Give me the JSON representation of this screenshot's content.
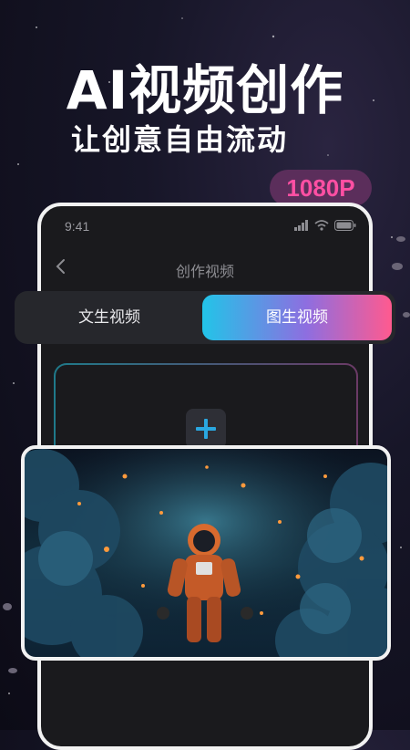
{
  "promo": {
    "headline": "AI视频创作",
    "subline": "让创意自由流动",
    "badge": "1080P"
  },
  "phone": {
    "status_time": "9:41",
    "nav_title": "创作视频",
    "icons": {
      "back": "chevron-left-icon",
      "signal": "signal-icon",
      "wifi": "wifi-icon",
      "battery": "battery-icon",
      "add": "plus-icon"
    }
  },
  "tabs": [
    {
      "label": "文生视频",
      "active": false
    },
    {
      "label": "图生视频",
      "active": true
    }
  ],
  "colors": {
    "tab_gradient_start": "#22c4e8",
    "tab_gradient_end": "#ff5a8f",
    "badge_text": "#ff4fa3",
    "plus_icon": "#2aa7e0"
  },
  "sample_image": {
    "subject": "astronaut-in-nebula"
  }
}
